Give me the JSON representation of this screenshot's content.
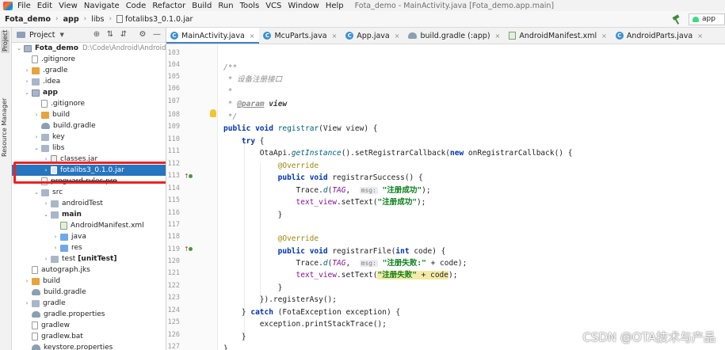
{
  "menubar": {
    "items": [
      "File",
      "Edit",
      "View",
      "Navigate",
      "Code",
      "Refactor",
      "Build",
      "Run",
      "Tools",
      "VCS",
      "Window",
      "Help"
    ],
    "window_title": "Fota_demo - MainActivity.java [Fota_demo.app.main]"
  },
  "breadcrumb": [
    "Fota_demo",
    "app",
    "libs",
    "fotalibs3_0.1.0.jar"
  ],
  "run_config": "app",
  "toolstrip": {
    "project_tab": "Project",
    "resource_manager_tab": "Resource Manager"
  },
  "project_panel": {
    "view_label": "Project"
  },
  "tree": [
    {
      "label": "Fota_demo",
      "path": "D:\\Code\\Android\\AndroidSt"
    },
    {
      "label": ".gitignore"
    },
    {
      "label": ".gradle"
    },
    {
      "label": ".idea"
    },
    {
      "label": "app"
    },
    {
      "label": ".gitignore"
    },
    {
      "label": "build"
    },
    {
      "label": "build.gradle"
    },
    {
      "label": "key"
    },
    {
      "label": "libs"
    },
    {
      "label": "classes.jar"
    },
    {
      "label": "fotalibs3_0.1.0.jar"
    },
    {
      "label": "proguard-rules.pro"
    },
    {
      "label": "src"
    },
    {
      "label": "androidTest"
    },
    {
      "label": "main"
    },
    {
      "label": "AndroidManifest.xml"
    },
    {
      "label": "java"
    },
    {
      "label": "res"
    },
    {
      "label": "test",
      "suffix": "[unitTest]"
    },
    {
      "label": "autograph.jks"
    },
    {
      "label": "build"
    },
    {
      "label": "build.gradle"
    },
    {
      "label": "gradle"
    },
    {
      "label": "gradle.properties"
    },
    {
      "label": "gradlew"
    },
    {
      "label": "gradlew.bat"
    },
    {
      "label": "keystore.properties"
    }
  ],
  "tabs": [
    "MainActivity.java",
    "McuParts.java",
    "App.java",
    "build.gradle (:app)",
    "AndroidManifest.xml",
    "AndroidParts.java"
  ],
  "line_numbers": [
    "103",
    "104",
    "105",
    "106",
    "107",
    "108",
    "109",
    "110",
    "111",
    "112",
    "113",
    "114",
    "115",
    "116",
    "117",
    "118",
    "119",
    "120",
    "121",
    "122",
    "123",
    "124",
    "125",
    "126",
    "127"
  ],
  "code": {
    "doc_open": "/**",
    "doc_title": "* 设备注册接口",
    "doc_star": "*",
    "doc_param_tag": "@param",
    "doc_param_name": "view",
    "doc_close": "*/",
    "m_public": "public",
    "m_void": "void",
    "m_name": "registrar",
    "m_sig": "(View view) {",
    "try_kw": "try",
    "try_brace": "{",
    "l111_cls": "OtaApi.",
    "l111_get": "getInstance",
    "l111_mid": "().setRegistrarCallback(",
    "l111_new": "new",
    "l111_end": "onRegistrarCallback() {",
    "override": "@Override",
    "l113_end": "registrarSuccess() {",
    "trace_cls": "Trace.",
    "trace_d": "d",
    "trace_open": "(",
    "trace_tag": "TAG",
    "trace_comma": ",",
    "hint_msg": "msg:",
    "success_str": "\"注册成功\"",
    "l114_close": ");",
    "text_view": "text_view",
    "settext": ".setText(",
    "close_brace": "}",
    "l119_mid": "registrarFile(",
    "l119_int": "int",
    "l119_end": "code) {",
    "fail_str": "\"注册失败:\"",
    "concat_code": " + code);",
    "fail_str2": "\"注册失败\"",
    "concat_code2": " + code",
    "l123_end": "}).registerAsy();",
    "catch_open": "} ",
    "catch_kw": "catch",
    "catch_end": " (FotaException exception) {",
    "print_stack": "exception.printStackTrace();"
  },
  "watermark": "CSDN @OTA技术与产品"
}
